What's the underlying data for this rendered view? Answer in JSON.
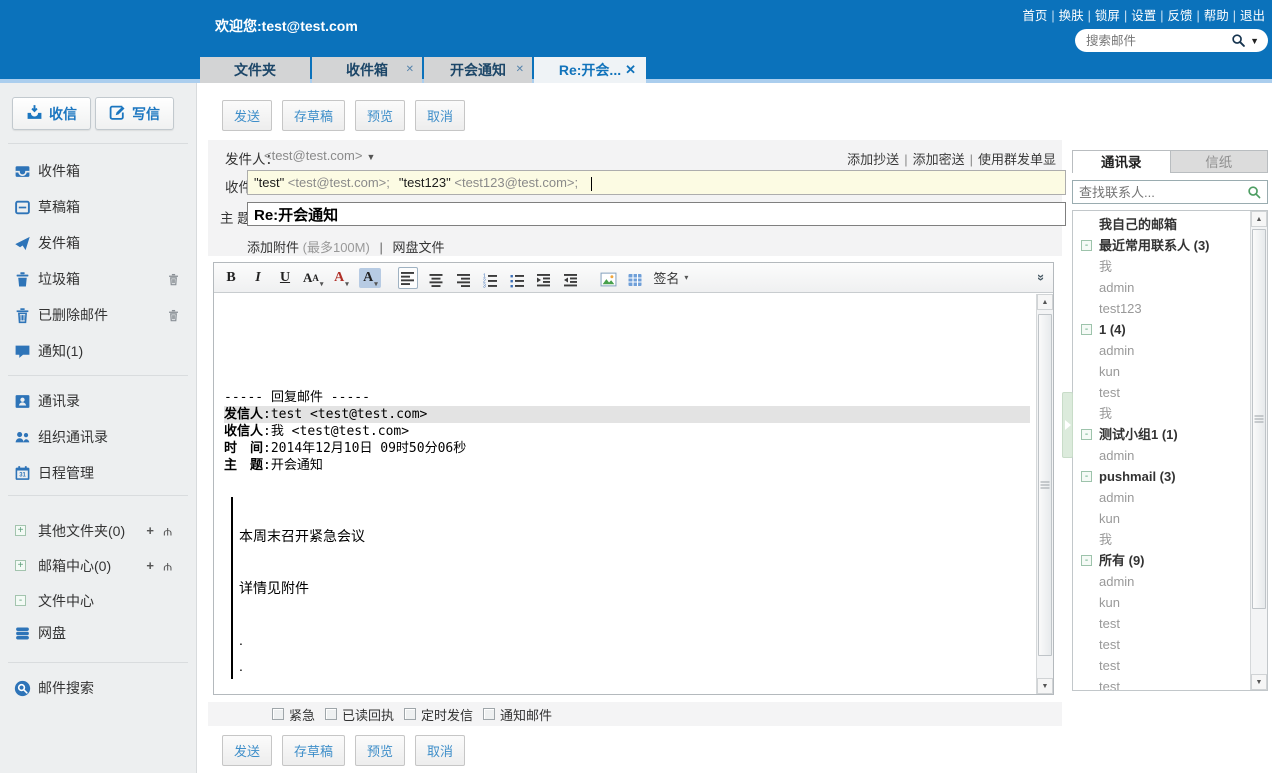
{
  "header": {
    "welcome": "欢迎您:test@test.com",
    "nav": [
      "首页",
      "换肤",
      "锁屏",
      "设置",
      "反馈",
      "帮助",
      "退出"
    ],
    "search_placeholder": "搜索邮件"
  },
  "tabs": [
    {
      "label": "文件夹",
      "closable": false,
      "active": false
    },
    {
      "label": "收件箱",
      "closable": true,
      "active": false
    },
    {
      "label": "开会通知",
      "closable": true,
      "active": false
    },
    {
      "label": "Re:开会...",
      "closable": true,
      "active": true
    }
  ],
  "sidebar": {
    "receive_button": "收信",
    "compose_button": "写信",
    "folders": [
      {
        "label": "收件箱",
        "icon": "inbox",
        "mini": false
      },
      {
        "label": "草稿箱",
        "icon": "draft",
        "mini": false
      },
      {
        "label": "发件箱",
        "icon": "sent",
        "mini": false
      },
      {
        "label": "垃圾箱",
        "icon": "trash",
        "mini": true
      },
      {
        "label": "已删除邮件",
        "icon": "trash2",
        "mini": true
      },
      {
        "label": "通知(1)",
        "icon": "bubble",
        "mini": false
      }
    ],
    "tools": [
      {
        "label": "通讯录",
        "icon": "card"
      },
      {
        "label": "组织通讯录",
        "icon": "people"
      },
      {
        "label": "日程管理",
        "icon": "calendar"
      }
    ],
    "expandables": [
      {
        "label": "其他文件夹(0)",
        "expanded": false,
        "actions": true
      },
      {
        "label": "邮箱中心(0)",
        "expanded": false,
        "actions": true
      },
      {
        "label": "文件中心",
        "expanded": true,
        "actions": false
      }
    ],
    "netdisk": {
      "label": "网盘",
      "icon": "disk"
    },
    "mail_search": {
      "label": "邮件搜索",
      "icon": "searchball"
    }
  },
  "compose": {
    "actions": [
      "发送",
      "存草稿",
      "预览",
      "取消"
    ],
    "from_label": "发件人：",
    "from_value": "<test@test.com>",
    "cc_links": [
      "添加抄送",
      "添加密送",
      "使用群发单显"
    ],
    "to_label": "收件人：",
    "recipients": [
      {
        "name": "\"test\"",
        "email": "<test@test.com>;"
      },
      {
        "name": "\"test123\"",
        "email": "<test123@test.com>;"
      }
    ],
    "subject_label": "主 题：",
    "subject_value": "Re:开会通知",
    "attach_link": "添加附件",
    "attach_hint": "(最多100M)",
    "netdisk_link": "网盘文件",
    "signature_label": "签名",
    "quote_header": "----- 回复邮件 -----",
    "quote_fields": [
      {
        "label": "发信人",
        "value": ":test <test@test.com>",
        "hl": true
      },
      {
        "label": "收信人",
        "value": ":我 <test@test.com>",
        "hl": false
      },
      {
        "label": "时　间",
        "value": ":2014年12月10日 09时50分06秒",
        "hl": false
      },
      {
        "label": "主　题",
        "value": ":开会通知",
        "hl": false
      }
    ],
    "quote_body": [
      "",
      "本周末召开紧急会议",
      "",
      "详情见附件",
      "",
      ".",
      "."
    ],
    "options": [
      "紧急",
      "已读回执",
      "定时发信",
      "通知邮件"
    ]
  },
  "contacts": {
    "tab_contacts": "通讯录",
    "tab_stationery": "信纸",
    "search_placeholder": "查找联系人...",
    "tree": [
      {
        "type": "b",
        "label": "我自己的邮箱"
      },
      {
        "type": "g",
        "label": "最近常用联系人 (3)"
      },
      {
        "type": "l",
        "label": "我"
      },
      {
        "type": "l",
        "label": "admin"
      },
      {
        "type": "l",
        "label": "test123"
      },
      {
        "type": "g",
        "label": "1 (4)"
      },
      {
        "type": "l",
        "label": "admin"
      },
      {
        "type": "l",
        "label": "kun"
      },
      {
        "type": "l",
        "label": "test"
      },
      {
        "type": "l",
        "label": "我"
      },
      {
        "type": "g",
        "label": "测试小组1 (1)"
      },
      {
        "type": "l",
        "label": "admin"
      },
      {
        "type": "g",
        "label": "pushmail (3)"
      },
      {
        "type": "l",
        "label": "admin"
      },
      {
        "type": "l",
        "label": "kun"
      },
      {
        "type": "l",
        "label": "我"
      },
      {
        "type": "g",
        "label": "所有 (9)"
      },
      {
        "type": "l",
        "label": "admin"
      },
      {
        "type": "l",
        "label": "kun"
      },
      {
        "type": "l",
        "label": "test"
      },
      {
        "type": "l",
        "label": "test"
      },
      {
        "type": "l",
        "label": "test"
      },
      {
        "type": "l",
        "label": "test"
      }
    ],
    "colors": {
      "accent_blue": "#0b72bb",
      "tree_green": "#56a578"
    }
  }
}
